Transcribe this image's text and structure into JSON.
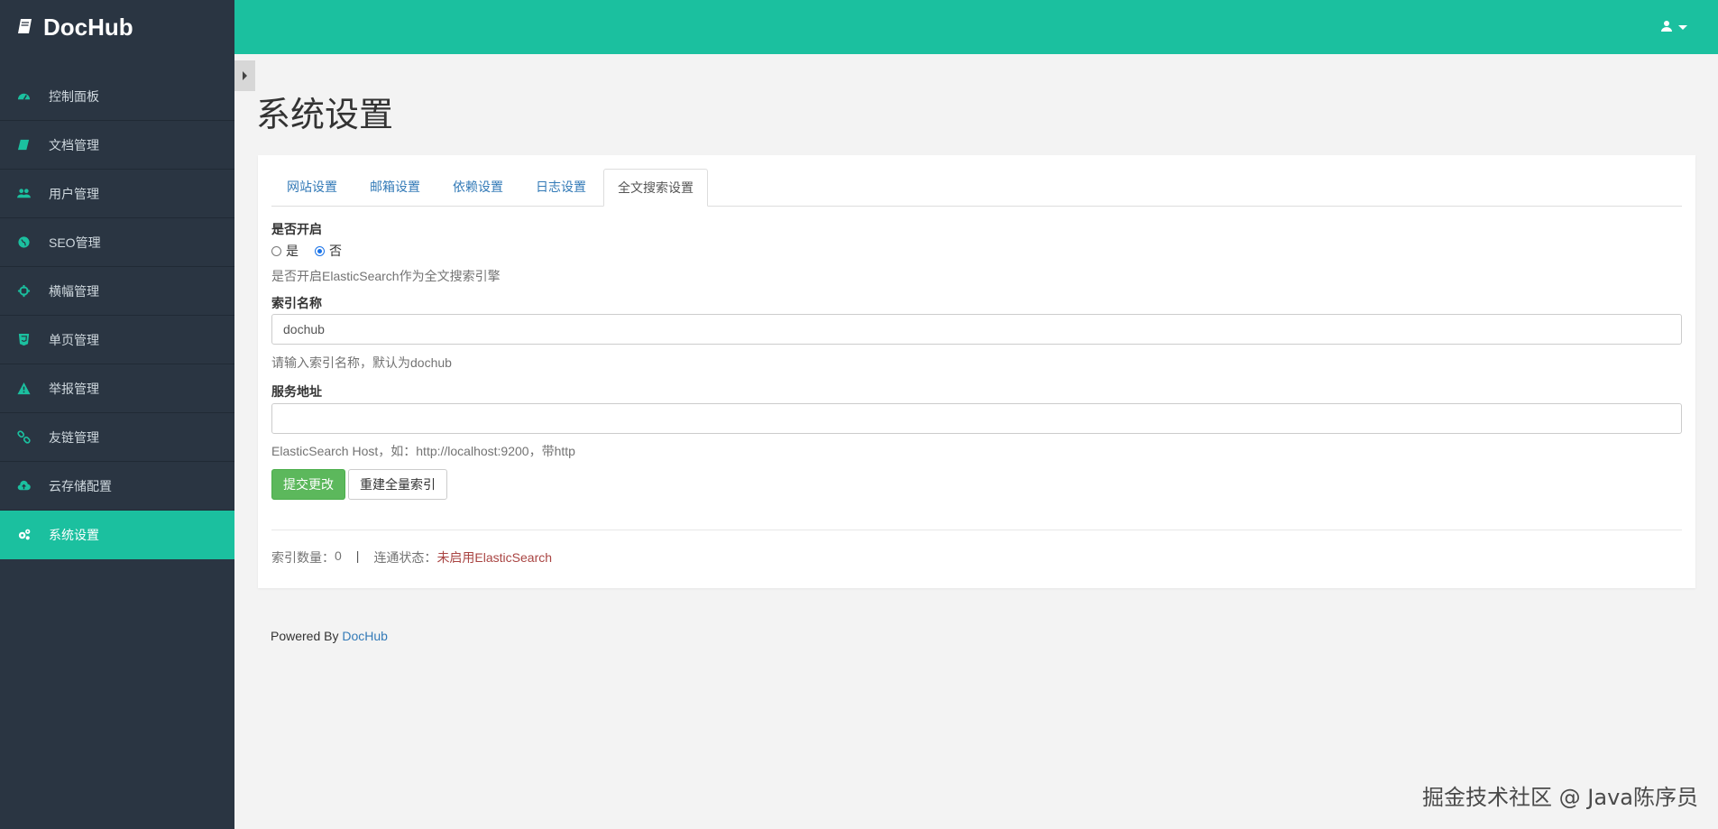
{
  "app": {
    "brand": "DocHub"
  },
  "sidebar": {
    "items": [
      {
        "label": "控制面板",
        "icon": "dashboard-icon"
      },
      {
        "label": "文档管理",
        "icon": "book-icon"
      },
      {
        "label": "用户管理",
        "icon": "users-icon"
      },
      {
        "label": "SEO管理",
        "icon": "globe-icon"
      },
      {
        "label": "横幅管理",
        "icon": "crosshair-icon"
      },
      {
        "label": "单页管理",
        "icon": "html5-icon"
      },
      {
        "label": "举报管理",
        "icon": "warning-icon"
      },
      {
        "label": "友链管理",
        "icon": "link-icon"
      },
      {
        "label": "云存储配置",
        "icon": "cloud-upload-icon"
      },
      {
        "label": "系统设置",
        "icon": "cogs-icon",
        "active": true
      }
    ]
  },
  "page": {
    "title": "系统设置"
  },
  "tabs": [
    {
      "label": "网站设置"
    },
    {
      "label": "邮箱设置"
    },
    {
      "label": "依赖设置"
    },
    {
      "label": "日志设置"
    },
    {
      "label": "全文搜索设置",
      "active": true
    }
  ],
  "form": {
    "enable": {
      "label": "是否开启",
      "options": [
        "是",
        "否"
      ],
      "selected": "否",
      "help": "是否开启ElasticSearch作为全文搜索引擎"
    },
    "index_name": {
      "label": "索引名称",
      "value": "dochub",
      "help": "请输入索引名称，默认为dochub"
    },
    "host": {
      "label": "服务地址",
      "value": "",
      "help": "ElasticSearch Host，如：http://localhost:9200，带http"
    },
    "buttons": {
      "submit": "提交更改",
      "rebuild": "重建全量索引"
    }
  },
  "status": {
    "count_label": "索引数量：",
    "count_value": "0",
    "separator": "|",
    "conn_label": "连通状态：",
    "conn_value": "未启用ElasticSearch"
  },
  "footer": {
    "powered_by": "Powered By ",
    "link": "DocHub"
  },
  "watermark": "掘金技术社区 @ Java陈序员",
  "colors": {
    "primary": "#1bc09f",
    "sidebar": "#2a3542",
    "success": "#5cb85c",
    "danger": "#a94442",
    "link": "#337ab7"
  }
}
